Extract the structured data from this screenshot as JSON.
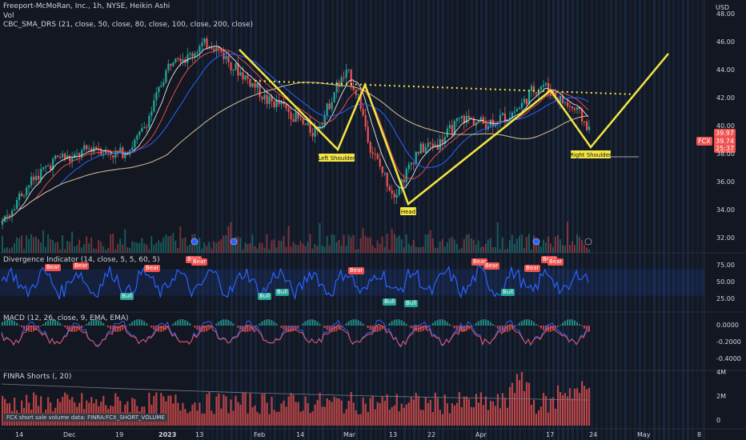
{
  "header": {
    "symbol_line": "Freeport-McMoRan, Inc., 1h, NYSE, Heikin Ashi",
    "vol_label": "Vol",
    "indicator_line": "CBC_SMA_DRS (21, close, 50, close, 80, close, 100, close, 200, close)"
  },
  "price_axis": {
    "currency": "USD",
    "ticks": [
      "48.00",
      "46.00",
      "44.00",
      "42.00",
      "40.00",
      "38.00",
      "36.00",
      "34.00",
      "32.00"
    ],
    "last_price": "39.97",
    "ticker_tag": "FCX",
    "close_tag": "39.74",
    "countdown_tag": "25:37"
  },
  "panes": {
    "divergence": {
      "title": "Divergence Indicator (14, close, 5, 5, 60, 5)",
      "ticks": [
        "75.00",
        "50.00",
        "25.00"
      ],
      "bear_label": "Bear",
      "bull_label": "Bull"
    },
    "macd": {
      "title": "MACD (12, 26, close, 9, EMA, EMA)",
      "ticks": [
        "0.0000",
        "-0.2000",
        "-0.4000"
      ]
    },
    "finra": {
      "title": "FINRA Shorts (, 20)",
      "ticks": [
        "4M",
        "2M",
        "0"
      ],
      "footer": "FCX short sale volume data: FINRA:FCX_SHORT_VOLUME"
    }
  },
  "time_axis": {
    "labels": [
      "14",
      "Dec",
      "19",
      "2023",
      "13",
      "Feb",
      "14",
      "Mar",
      "13",
      "22",
      "Apr",
      "17",
      "24",
      "May",
      "8"
    ]
  },
  "chart_data": {
    "type": "line",
    "ylim": [
      31,
      49
    ],
    "price_series": [
      33,
      34.5,
      35.6,
      36.5,
      37.2,
      37.9,
      37.6,
      38.2,
      38.6,
      38.2,
      38.0,
      38.4,
      39.4,
      41.2,
      43.5,
      45.3,
      44.8,
      45.6,
      46.0,
      45.3,
      44.3,
      43.6,
      42.8,
      41.8,
      41.6,
      41.0,
      40.2,
      39.6,
      40.8,
      42.8,
      43.8,
      42.0,
      38.5,
      36.8,
      35.2,
      36.5,
      38.2,
      38.6,
      38.8,
      39.8,
      40.6,
      40.4,
      40.2,
      40.5,
      40.8,
      41.4,
      42.5,
      43.0,
      42.2,
      41.6,
      41.0,
      39.8
    ],
    "pattern_annotations": {
      "zigzag_points": [
        [
          299,
          62
        ],
        [
          422,
          187
        ],
        [
          456,
          106
        ],
        [
          510,
          255
        ],
        [
          688,
          113
        ],
        [
          738,
          184
        ],
        [
          835,
          67
        ]
      ],
      "neckline_level": 44.0,
      "label_left": "Left Shoulder",
      "label_head": "Head",
      "label_right": "Right Shoulder"
    }
  },
  "colors": {
    "background": "#131722",
    "up": "#26a69a",
    "down": "#ef5350",
    "pattern": "#f5e642",
    "line_blue": "#2962ff",
    "session_shade": "#1e3a5f"
  }
}
